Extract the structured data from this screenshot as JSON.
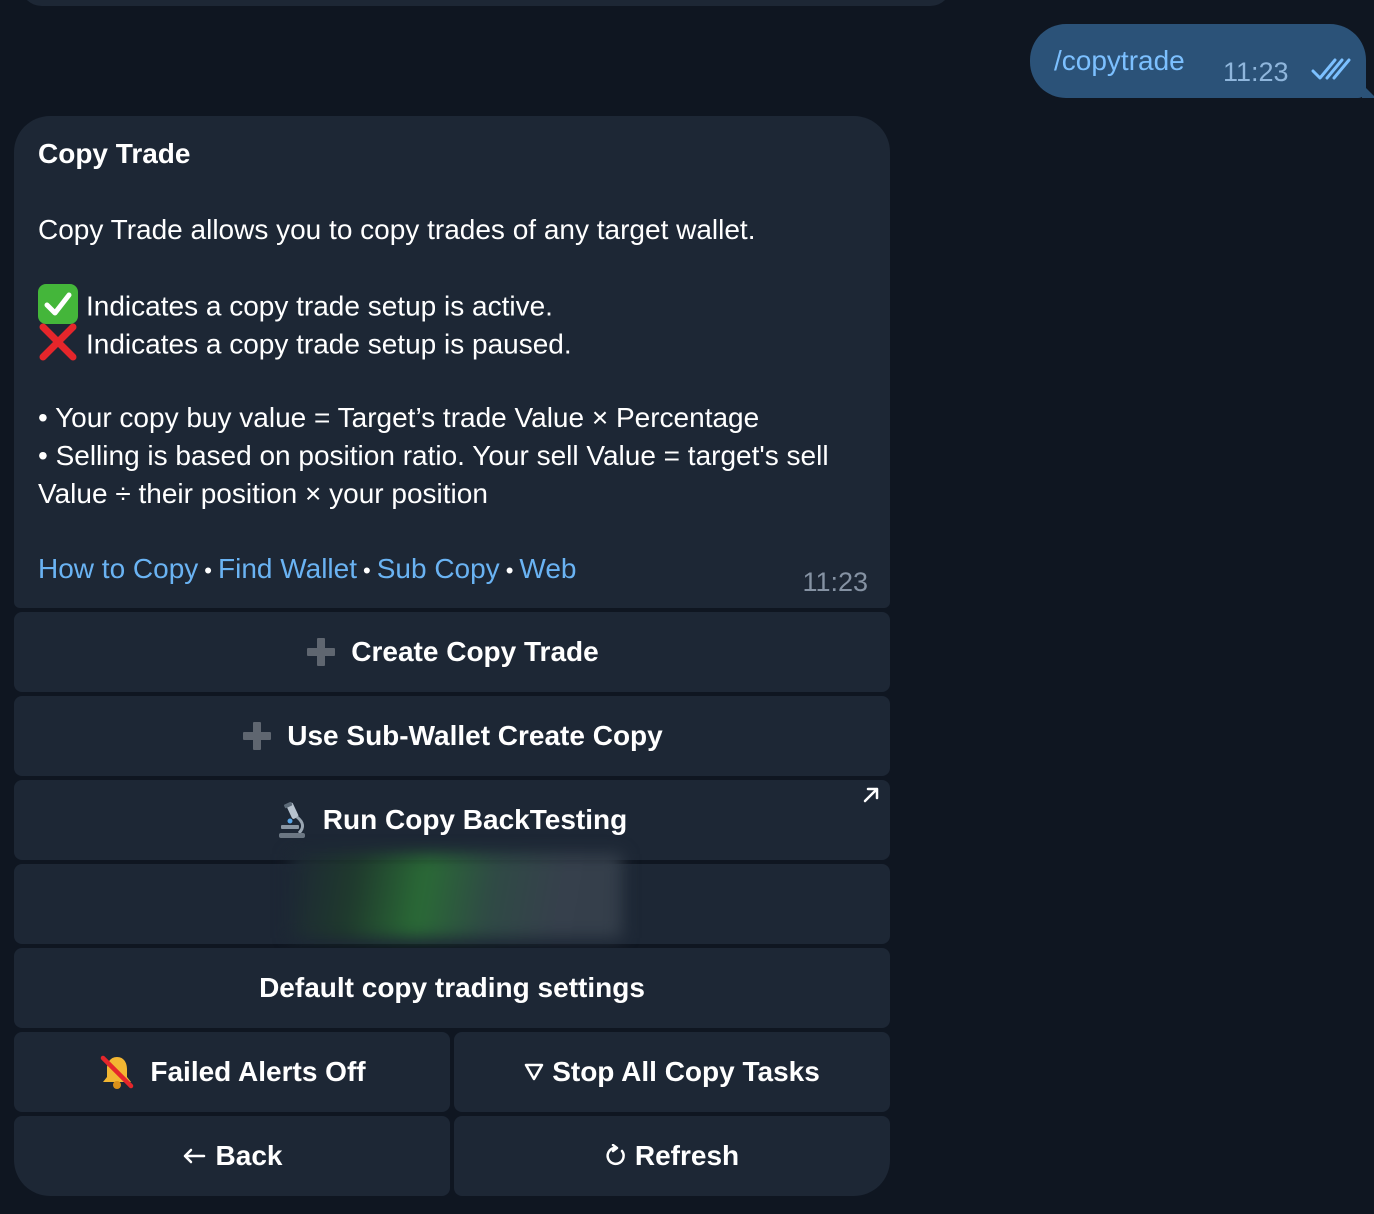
{
  "outgoing": {
    "text": "/copytrade",
    "time": "11:23"
  },
  "message": {
    "title": "Copy Trade",
    "intro": "Copy Trade allows you to copy trades of any target wallet.",
    "active_line": "Indicates a copy trade setup is active.",
    "paused_line": "Indicates a copy trade setup is paused.",
    "bullet1": " • Your copy buy value = Target’s trade Value × Percentage",
    "bullet2a": " • Selling is based on position ratio. Your sell Value = target's sell",
    "bullet2b": "Value ÷ their position × your position",
    "links": [
      "How to Copy",
      "Find Wallet",
      "Sub Copy",
      "Web"
    ],
    "link_separator": "•",
    "time": "11:23"
  },
  "keyboard": {
    "create_copy_trade": "Create Copy Trade",
    "use_subwallet": "Use Sub-Wallet Create Copy",
    "run_backtesting": "Run Copy BackTesting",
    "default_settings": "Default copy trading settings",
    "failed_alerts": "Failed Alerts Off",
    "stop_all": "Stop All Copy Tasks",
    "back": "Back",
    "refresh": "Refresh"
  },
  "colors": {
    "background": "#0f1621",
    "bubble_in": "#1d2735",
    "bubble_out": "#2b5278",
    "link": "#6ab3f3"
  },
  "icons": {
    "active": "check-mark-icon",
    "paused": "cross-mark-icon",
    "create": "plus-icon",
    "backtest": "microscope-icon",
    "alerts": "bell-slash-icon",
    "stop": "triangle-down-icon",
    "back": "left-arrow-icon",
    "refresh": "refresh-icon"
  }
}
